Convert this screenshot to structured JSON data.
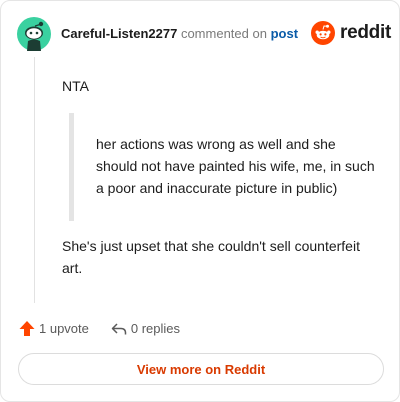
{
  "header": {
    "username": "Careful-Listen2277",
    "commented_on_text": "commented on",
    "post_link_text": "post",
    "brand_text": "reddit"
  },
  "comment": {
    "paragraph1": "NTA",
    "quote": "her actions was wrong as well and she should not have painted his wife, me, in such a poor and inaccurate picture in public)",
    "paragraph2": "She's just upset that she couldn't sell counterfeit art."
  },
  "actions": {
    "upvotes": "1 upvote",
    "replies": "0 replies"
  },
  "footer": {
    "view_button": "View more on Reddit"
  },
  "colors": {
    "brand_orange": "#ff4500",
    "avatar_teal": "#3ad1a0",
    "link_blue": "#0a5ba8",
    "button_text": "#d93a00"
  },
  "icons": [
    "avatar-snoo-icon",
    "reddit-logo-icon",
    "upvote-arrow-icon",
    "reply-icon"
  ]
}
